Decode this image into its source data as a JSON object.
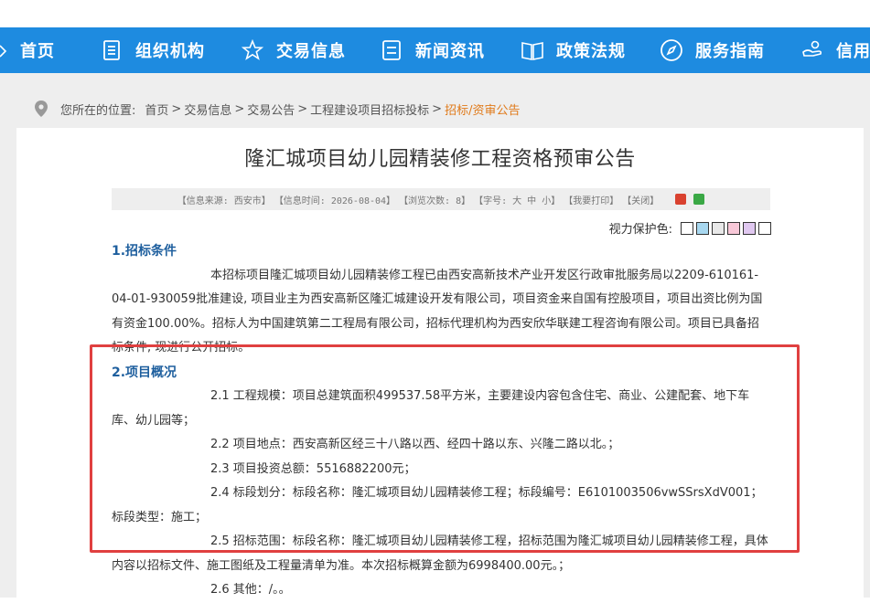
{
  "nav": {
    "items": [
      {
        "label": "首页",
        "icon": "home-icon"
      },
      {
        "label": "组织机构",
        "icon": "document-icon"
      },
      {
        "label": "交易信息",
        "icon": "star-icon"
      },
      {
        "label": "新闻资讯",
        "icon": "list-icon"
      },
      {
        "label": "政策法规",
        "icon": "book-icon"
      },
      {
        "label": "服务指南",
        "icon": "compass-icon"
      },
      {
        "label": "信用",
        "icon": "hand-icon"
      }
    ]
  },
  "breadcrumb": {
    "prefix": "您所在的位置:",
    "items": [
      "首页",
      "交易信息",
      "交易公告",
      "工程建设项目招标投标"
    ],
    "current": "招标/资审公告"
  },
  "article": {
    "title": "隆汇城项目幼儿园精装修工程资格预审公告",
    "info": {
      "source": "【信息来源: 西安市】",
      "time": "【信息时间: 2026-08-04】",
      "views": "【浏览次数: 8】",
      "font": "【字号: 大 中 小】",
      "print": "【我要打印】",
      "close": "【关闭】"
    },
    "vision_label": "视力保护色:",
    "vision_colors": [
      "#ffffff",
      "#a8d8f0",
      "#e8e8e8",
      "#f8c8d8",
      "#e0c8f0",
      "#ffffff"
    ],
    "sections": {
      "s1_heading": "1.招标条件",
      "s1_body": "本招标项目隆汇城项目幼儿园精装修工程已由西安高新技术产业开发区行政审批服务局以2209-610161-04-01-930059批准建设, 项目业主为西安高新区隆汇城建设开发有限公司，项目资金来自国有控股项目，项目出资比例为国有资金100.00%。招标人为中国建筑第二工程局有限公司，招标代理机构为西安欣华联建工程咨询有限公司。项目已具备招标条件, 现进行公开招标。",
      "s2_heading": "2.项目概况",
      "p21": "2.1 工程规模：项目总建筑面积499537.58平方米，主要建设内容包含住宅、商业、公建配套、地下车库、幼儿园等；",
      "p22": "2.2 项目地点：西安高新区经三十八路以西、经四十路以东、兴隆二路以北。；",
      "p23": "2.3 项目投资总额：5516882200元；",
      "p24": "2.4 标段划分：标段名称：隆汇城项目幼儿园精装修工程；标段编号：E6101003506vwSSrsXdV001；标段类型：施工；",
      "p25": "2.5 招标范围：标段名称：隆汇城项目幼儿园精装修工程，招标范围为隆汇城项目幼儿园精装修工程，具体内容以招标文件、施工图纸及工程量清单为准。本次招标概算金额为6998400.00元。；",
      "p26": "2.6 其他：/。。"
    }
  },
  "colors": {
    "nav_bg": "#1e8be0",
    "highlight": "#e04040",
    "heading": "#1e5f9e",
    "current_crumb": "#e07a1a"
  }
}
